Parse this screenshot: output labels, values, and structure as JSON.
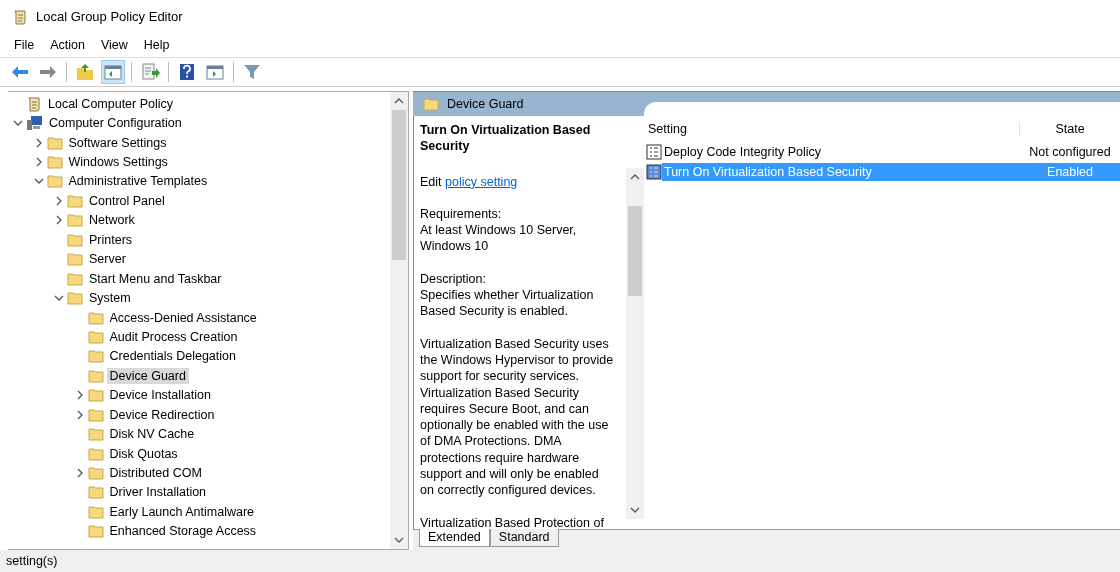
{
  "window": {
    "title": "Local Group Policy Editor"
  },
  "menu": [
    "File",
    "Action",
    "View",
    "Help"
  ],
  "toolbar": [
    {
      "selected": false
    },
    {
      "selected": false
    },
    {
      "selected": false
    },
    {
      "selected": true
    },
    {
      "selected": false
    },
    {
      "selected": false
    },
    {
      "selected": false
    },
    {
      "selected": false
    }
  ],
  "tree": [
    {
      "label": "Local Computer Policy",
      "selected": false
    },
    {
      "label": "Computer Configuration",
      "expanded": true,
      "selected": false,
      "children": [
        {
          "label": "Software Settings",
          "expanded": false,
          "selected": false
        },
        {
          "label": "Windows Settings",
          "expanded": false,
          "selected": false
        },
        {
          "label": "Administrative Templates",
          "expanded": true,
          "selected": false,
          "children": [
            {
              "label": "Control Panel",
              "expanded": false,
              "selected": false
            },
            {
              "label": "Network",
              "expanded": false,
              "selected": false
            },
            {
              "label": "Printers",
              "selected": false
            },
            {
              "label": "Server",
              "selected": false
            },
            {
              "label": "Start Menu and Taskbar",
              "selected": false
            },
            {
              "label": "System",
              "expanded": true,
              "selected": false,
              "children": [
                {
                  "label": "Access-Denied Assistance",
                  "selected": false
                },
                {
                  "label": "Audit Process Creation",
                  "selected": false
                },
                {
                  "label": "Credentials Delegation",
                  "selected": false
                },
                {
                  "label": "Device Guard",
                  "selected": true
                },
                {
                  "label": "Device Installation",
                  "expanded": false,
                  "selected": false
                },
                {
                  "label": "Device Redirection",
                  "expanded": false,
                  "selected": false
                },
                {
                  "label": "Disk NV Cache",
                  "selected": false
                },
                {
                  "label": "Disk Quotas",
                  "selected": false
                },
                {
                  "label": "Distributed COM",
                  "expanded": false,
                  "selected": false
                },
                {
                  "label": "Driver Installation",
                  "selected": false
                },
                {
                  "label": "Early Launch Antimalware",
                  "selected": false
                },
                {
                  "label": "Enhanced Storage Access",
                  "selected": false
                }
              ]
            }
          ]
        }
      ]
    }
  ],
  "header": {
    "title": "Device Guard"
  },
  "description": {
    "title": "Turn On Virtualization Based Security",
    "edit_prefix": "Edit",
    "edit_link": "policy setting",
    "sections": [
      {
        "label": "Requirements:",
        "text": "At least Windows 10 Server, Windows 10"
      },
      {
        "label": "Description:",
        "text": "Specifies whether Virtualization Based Security is enabled."
      },
      {
        "text": "Virtualization Based Security uses the Windows Hypervisor to provide support for security services.  Virtualization Based Security requires Secure Boot, and can optionally be enabled with the use of DMA Protections.  DMA protections require hardware support and will only be enabled on correctly configured devices."
      },
      {
        "text": "Virtualization Based Protection of"
      }
    ]
  },
  "list": {
    "columns": [
      "Setting",
      "State"
    ],
    "rows": [
      {
        "name": "Deploy Code Integrity Policy",
        "state": "Not configured",
        "selected": false
      },
      {
        "name": "Turn On Virtualization Based Security",
        "state": "Enabled",
        "selected": true
      }
    ]
  },
  "tabs": [
    {
      "label": "Extended",
      "selected": true
    },
    {
      "label": "Standard",
      "selected": false
    }
  ],
  "status_bar": "setting(s)"
}
